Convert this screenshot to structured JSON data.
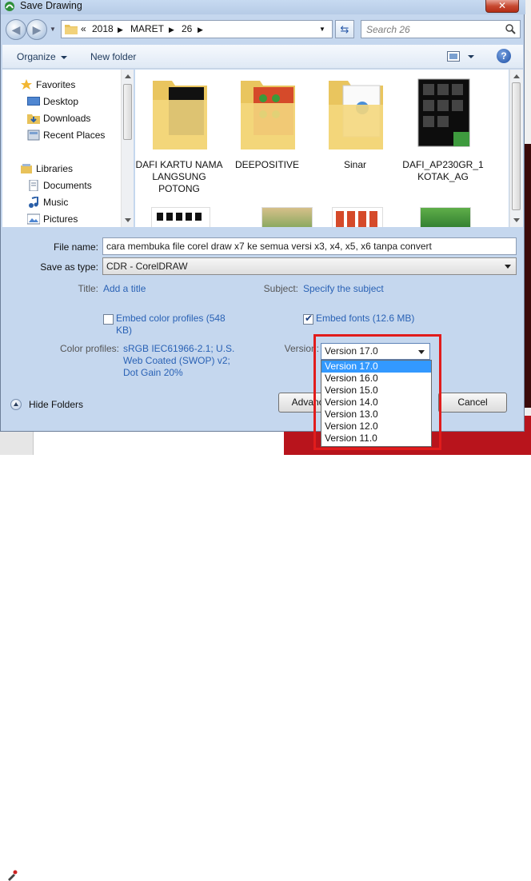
{
  "window": {
    "title": "Save Drawing",
    "close_label": "✕"
  },
  "nav": {
    "history_glyph": "«",
    "path": [
      "2018",
      "MARET",
      "26"
    ],
    "separator": "▶",
    "search_placeholder": "Search 26"
  },
  "toolbar": {
    "organize_label": "Organize",
    "new_folder_label": "New folder",
    "help_label": "?"
  },
  "sidebar": {
    "favorites_label": "Favorites",
    "items": [
      "Desktop",
      "Downloads",
      "Recent Places"
    ],
    "libraries_label": "Libraries",
    "library_items": [
      "Documents",
      "Music",
      "Pictures"
    ]
  },
  "files": [
    {
      "name": "DAFI KARTU NAMA LANGSUNG POTONG"
    },
    {
      "name": "DEEPOSITIVE"
    },
    {
      "name": "Sinar"
    },
    {
      "name": "DAFI_AP230GR_1 KOTAK_AG"
    }
  ],
  "form": {
    "file_name_label": "File name:",
    "file_name_value": "cara membuka file corel draw x7 ke semua versi x3, x4, x5, x6 tanpa convert",
    "save_type_label": "Save as type:",
    "save_type_value": "CDR - CorelDRAW",
    "title_label": "Title:",
    "title_link": "Add a title",
    "subject_label": "Subject:",
    "subject_link": "Specify the subject",
    "embed_color_label": "Embed color profiles (548",
    "embed_color_label2": "KB)",
    "embed_fonts_label": "Embed fonts (12.6 MB)",
    "color_profiles_label": "Color profiles:",
    "color_profiles_value": [
      "sRGB IEC61966-2.1; U.S.",
      "Web Coated (SWOP) v2;",
      "Dot Gain 20%"
    ],
    "version_label": "Version:",
    "version_value": "Version 17.0",
    "version_options": [
      "Version 17.0",
      "Version 16.0",
      "Version 15.0",
      "Version 14.0",
      "Version 13.0",
      "Version 12.0",
      "Version 11.0"
    ]
  },
  "footer": {
    "hide_folders_label": "Hide Folders",
    "advanced_label": "Advance",
    "cancel_label": "Cancel"
  },
  "colors": {
    "accent_highlight": "#e11c1c",
    "selected_option": "#3399ff"
  }
}
